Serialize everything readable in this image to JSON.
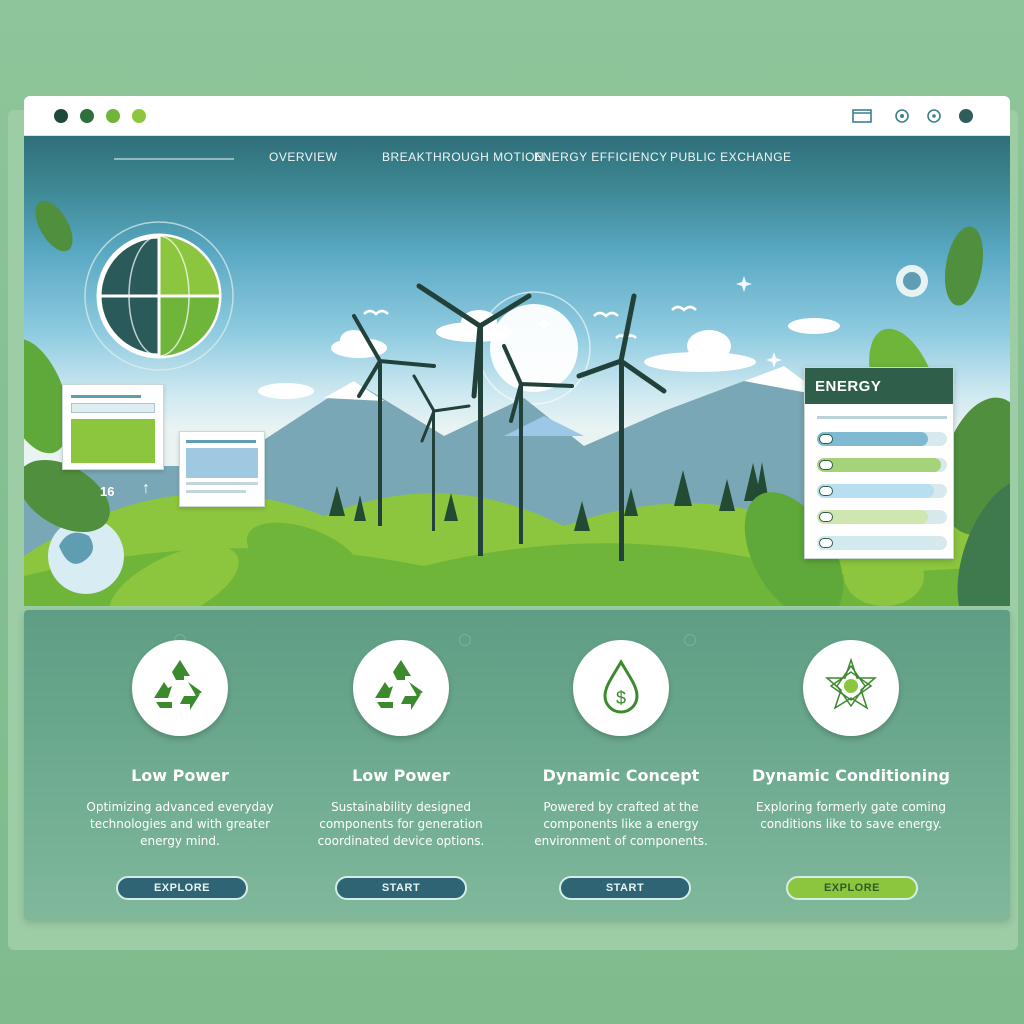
{
  "window": {
    "controls": [
      "close",
      "minimize",
      "maximize",
      "extra"
    ],
    "control_colors": [
      "#1f4a3a",
      "#2f6f3c",
      "#6fb53a",
      "#8cc63e"
    ],
    "toolbar_icons": [
      "window-icon",
      "settings-icon",
      "refresh-icon",
      "account-icon"
    ]
  },
  "nav": {
    "items": [
      {
        "label": "OVERVIEW"
      },
      {
        "label": "BREAKTHROUGH MOTION"
      },
      {
        "label": "ENERGY EFFICIENCY"
      },
      {
        "label": "PUBLIC EXCHANGE"
      }
    ]
  },
  "hero": {
    "scene": "wind turbines over green hills with mountains, sun, clouds and birds",
    "badge_text": "16",
    "badge_icon": "arrow-up-icon"
  },
  "energy_panel": {
    "title": "ENERGY",
    "rows": [
      {
        "label": "0",
        "level": 0.85,
        "color": "#7fb9d2"
      },
      {
        "label": "0",
        "level": 0.95,
        "color": "#a6d27a"
      },
      {
        "label": "0",
        "level": 0.9,
        "color": "#b8dff0"
      },
      {
        "label": "0",
        "level": 0.85,
        "color": "#cfe6b0"
      },
      {
        "label": "OIO",
        "level": 0.9,
        "color": "#d2e9f0"
      }
    ]
  },
  "features": [
    {
      "icon": "recycle-icon",
      "title": "Low Power",
      "description": "Optimizing advanced everyday technologies and with greater energy mind.",
      "button": "EXPLORE",
      "button_style": "dark"
    },
    {
      "icon": "recycle-icon",
      "title": "Low Power",
      "description": "Sustainability designed components for generation coordinated device options.",
      "button": "START",
      "button_style": "dark"
    },
    {
      "icon": "water-drop-dollar-icon",
      "title": "Dynamic Concept",
      "description": "Powered by crafted at the components like a energy environment of components.",
      "button": "START",
      "button_style": "dark"
    },
    {
      "icon": "star-burst-icon",
      "title": "Dynamic Conditioning",
      "description": "Exploring formerly gate coming conditions like to save energy.",
      "button": "EXPLORE",
      "button_style": "green"
    }
  ]
}
